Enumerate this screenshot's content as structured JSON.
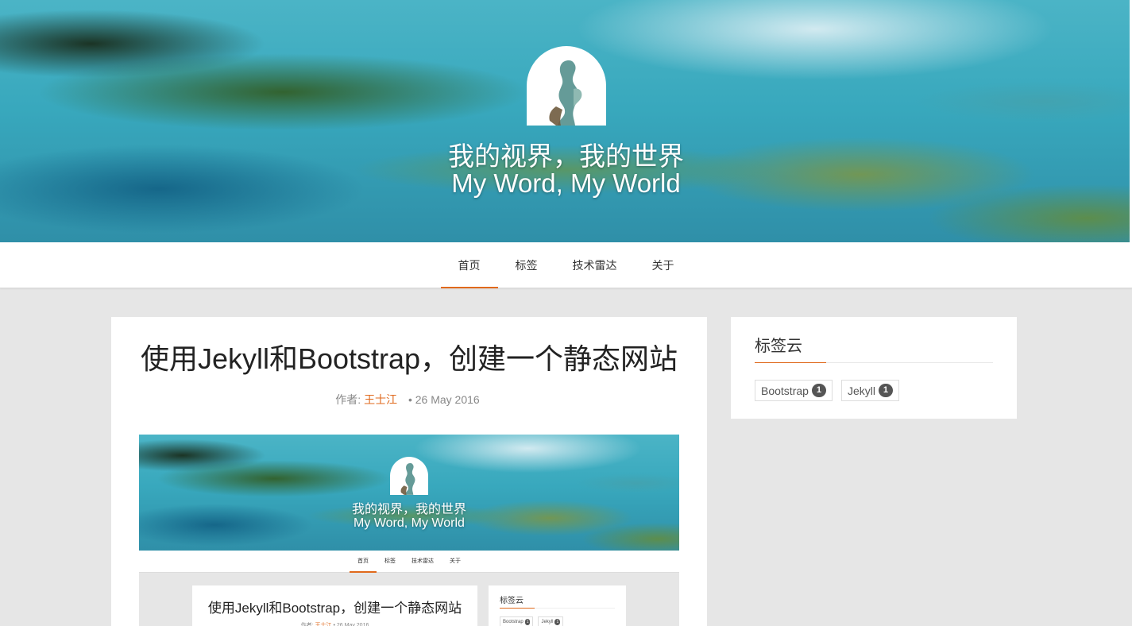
{
  "header": {
    "title_cn": "我的视界，我的世界",
    "title_en": "My Word, My World",
    "logo_icon": "mermaid-silhouette-icon"
  },
  "nav": {
    "items": [
      {
        "label": "首页",
        "active": true
      },
      {
        "label": "标签",
        "active": false
      },
      {
        "label": "技术雷达",
        "active": false
      },
      {
        "label": "关于",
        "active": false
      }
    ]
  },
  "post": {
    "title": "使用Jekyll和Bootstrap，创建一个静态网站",
    "author_prefix": "作者:",
    "author": "王士江",
    "date": "• 26 May 2016"
  },
  "sidebar": {
    "title": "标签云",
    "tags": [
      {
        "name": "Bootstrap",
        "count": "1"
      },
      {
        "name": "Jekyll",
        "count": "1"
      }
    ]
  },
  "colors": {
    "accent": "#e0691c",
    "background": "#e6e6e6",
    "badge": "#555555"
  }
}
